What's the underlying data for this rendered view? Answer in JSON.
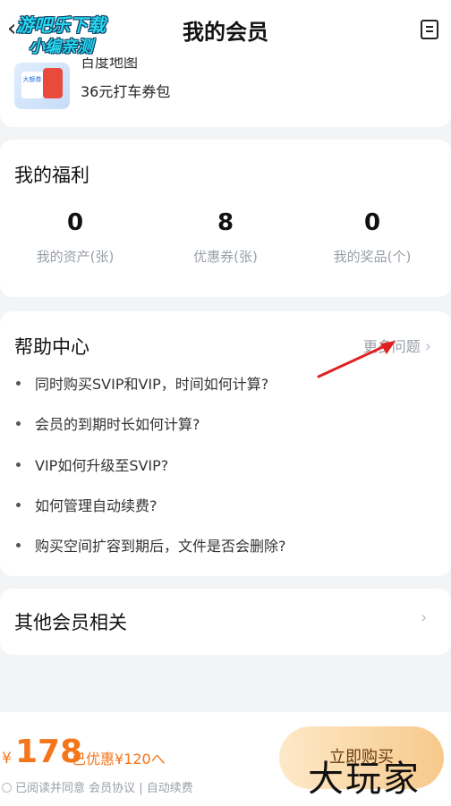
{
  "header": {
    "title": "我的会员",
    "watermark_line1": "游吧乐下载",
    "watermark_line2": "小编亲测"
  },
  "top_card": {
    "thumb_text": "大额券",
    "map_label": "百度地图",
    "coupon_label": "36元打车券包"
  },
  "benefits": {
    "title": "我的福利",
    "stats": [
      {
        "value": "0",
        "label": "我的资产(张)"
      },
      {
        "value": "8",
        "label": "优惠券(张)"
      },
      {
        "value": "0",
        "label": "我的奖品(个)"
      }
    ]
  },
  "help": {
    "title": "帮助中心",
    "more_label": "更多问题",
    "faqs": [
      "同时购买SVIP和VIP，时间如何计算?",
      "会员的到期时长如何计算?",
      "VIP如何升级至SVIP?",
      "如何管理自动续费?",
      "购买空间扩容到期后，文件是否会删除?"
    ]
  },
  "other": {
    "title": "其他会员相关"
  },
  "bottom": {
    "currency": "¥",
    "price": "178",
    "discount": "已优惠¥120へ",
    "agree_text": "已阅读并同意 会员协议 | 自动续费",
    "buy_label": "立即购买",
    "stamp": "大玩家"
  },
  "colors": {
    "accent": "#f4751a",
    "annotation_arrow": "#e02020"
  }
}
